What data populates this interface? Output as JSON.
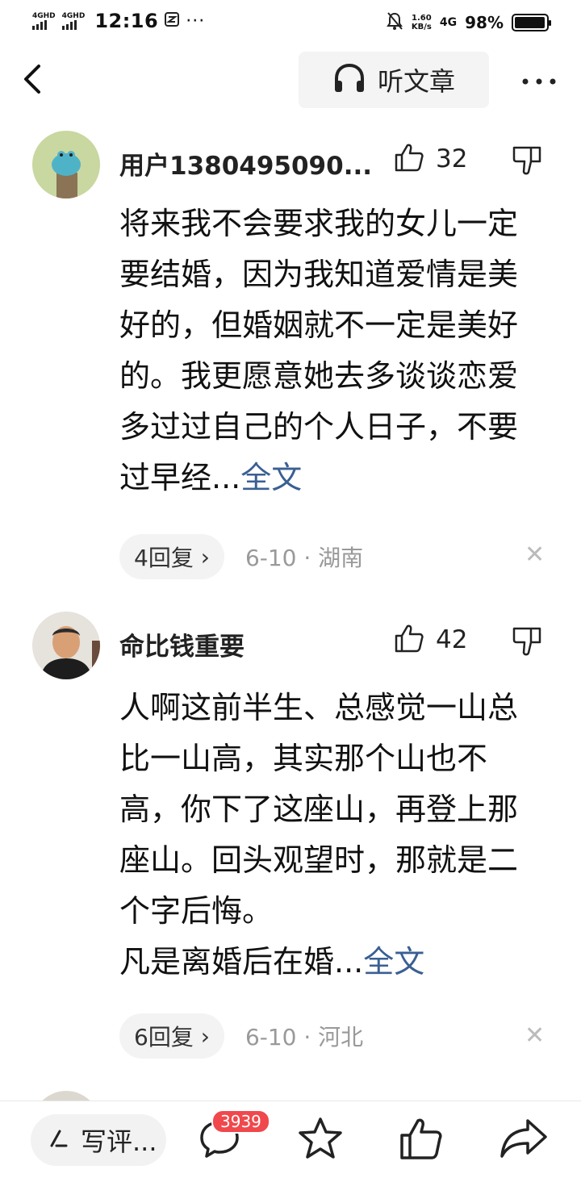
{
  "status_bar": {
    "signal1_label": "4GHD",
    "signal2_label": "4GHD",
    "time": "12:16",
    "dots": "···",
    "speed_value": "1.60",
    "speed_unit": "KB/s",
    "network": "4G",
    "battery_percent": "98%",
    "battery_level": 0.98
  },
  "nav": {
    "listen_label": "听文章"
  },
  "comments": [
    {
      "username": "用户1380495090...",
      "likes": "32",
      "body": "将来我不会要求我的女儿一定要结婚，因为我知道爱情是美好的，但婚姻就不一定是美好的。我更愿意她去多谈谈恋爱多过过自己的个人日子，不要过早经...",
      "full_text_link": "全文",
      "replies": "4回复",
      "date_location": "6-10 · 湖南"
    },
    {
      "username": "命比钱重要",
      "likes": "42",
      "body_lines": [
        "人啊这前半生、总感觉一山总比一山高，其实那个山也不高，你下了这座山，再登上那座山。回头观望时，那就是二个字后悔。",
        "凡是离婚后在婚..."
      ],
      "full_text_link": "全文",
      "replies": "6回复",
      "date_location": "6-10 · 河北"
    }
  ],
  "bottom_bar": {
    "write_label": "写评...",
    "comment_count": "3939"
  },
  "colors": {
    "link": "#3a5f93",
    "badge": "#f0484c",
    "meta_gray": "#999999"
  }
}
